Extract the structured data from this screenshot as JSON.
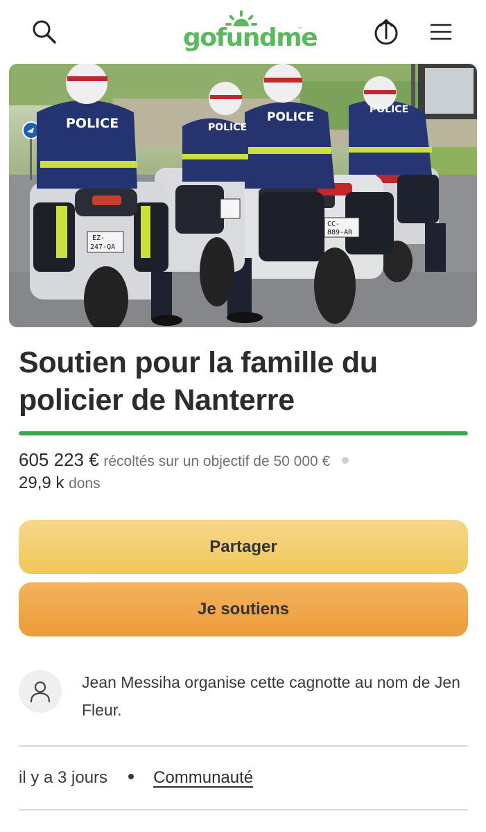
{
  "header": {
    "logo_text": "gofundme",
    "logo_tm": "™",
    "brand_color": "#5bb85c",
    "icons": [
      "search-icon",
      "share-upload-icon",
      "menu-icon"
    ]
  },
  "campaign": {
    "title_line1": "Soutien pour la famille du",
    "title_line2": "policier de Nanterre",
    "raised_amount": "605 223 €",
    "raised_label": "récoltés sur un objectif de 50 000 €",
    "progress_fraction": 1.0,
    "donations_count": "29,9 k",
    "donations_label": "dons",
    "progress_color": "#3ea355"
  },
  "photo": {
    "plate_1": "EZ 247 QA",
    "plate_2": "CC 889 AR",
    "police_label": "POLICE"
  },
  "actions": {
    "share_label": "Partager",
    "donate_label": "Je soutiens"
  },
  "organizer": {
    "text": "Jean Messiha organise cette cagnotte au nom de Jen Fleur.",
    "avatar_icon": "user-icon"
  },
  "meta": {
    "posted": "il y a 3 jours",
    "category": "Communauté"
  }
}
